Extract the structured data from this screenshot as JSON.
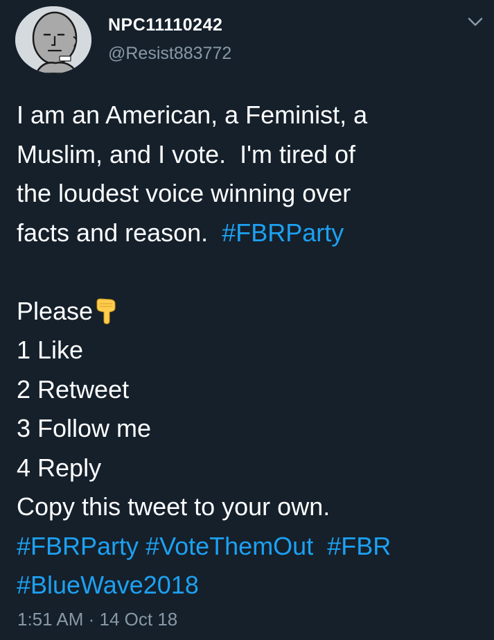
{
  "colors": {
    "background": "#15202b",
    "text": "#ffffff",
    "secondary": "#8899a6",
    "link": "#1da1f2"
  },
  "author": {
    "display_name": "NPC11110242",
    "handle": "@Resist883772",
    "avatar_icon": "npc-face-avatar"
  },
  "menu": {
    "icon": "chevron-down-icon"
  },
  "tweet": {
    "line1": "I am an American, a Feminist, a",
    "line2": "Muslim, and I vote.  I'm tired of",
    "line3": "the loudest voice winning over",
    "line4_text": "facts and reason.  ",
    "line4_hashtag": "#FBRParty",
    "please": "Please",
    "please_emoji": "backhand-index-pointing-down",
    "step1": "1 Like",
    "step2": "2 Retweet",
    "step3": "3 Follow me",
    "step4": "4 Reply",
    "copy_line": "Copy this tweet to your own.",
    "hashtags_line1": [
      "#FBRParty",
      "#VoteThemOut",
      "#FBR"
    ],
    "hashtags_line2": [
      "#BlueWave2018"
    ]
  },
  "timestamp": "1:51 AM · 14 Oct 18"
}
